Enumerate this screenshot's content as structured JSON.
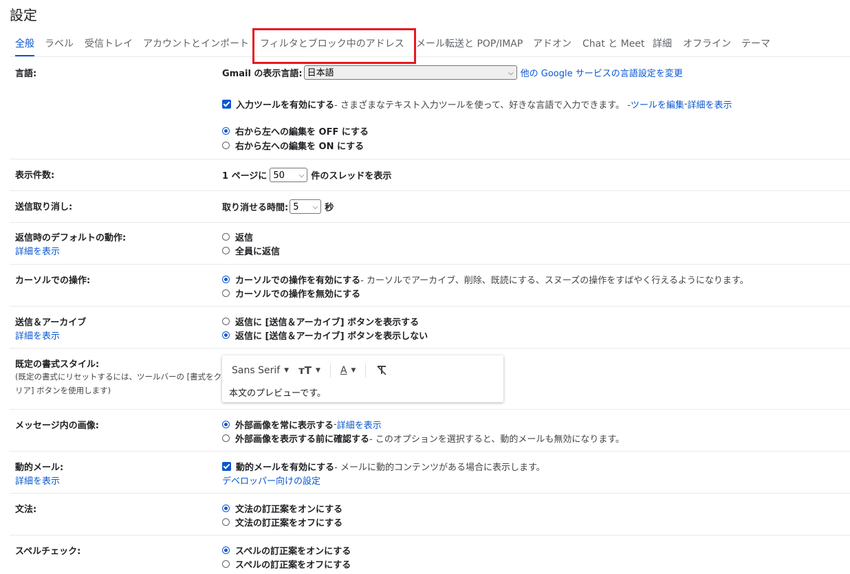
{
  "page_title": "設定",
  "tabs": [
    "全般",
    "ラベル",
    "受信トレイ",
    "アカウントとインポート",
    "フィルタとブロック中のアドレス",
    "メール転送と POP/IMAP",
    "アドオン",
    "Chat と Meet",
    "詳細",
    "オフライン",
    "テーマ"
  ],
  "active_tab": "全般",
  "highlighted_tab": "フィルタとブロック中のアドレス",
  "language": {
    "label": "言語:",
    "display_lang_label": "Gmail の表示言語:",
    "display_lang_value": "日本語",
    "other_services_link": "他の Google サービスの言語設定を変更",
    "input_tools_label": "入力ツールを有効にする",
    "input_tools_desc": " - さまざまなテキスト入力ツールを使って、好きな言語で入力できます。 - ",
    "edit_tools_link": "ツールを編集",
    "dash": " - ",
    "details_link": "詳細を表示",
    "rtl_off": "右から左への編集を OFF にする",
    "rtl_on": "右から左への編集を ON にする"
  },
  "page_size": {
    "label": "表示件数:",
    "prefix": "1 ページに",
    "value": "50",
    "suffix": "件のスレッドを表示"
  },
  "undo_send": {
    "label": "送信取り消し:",
    "prefix": "取り消せる時間:",
    "value": "5",
    "suffix": "秒"
  },
  "reply_default": {
    "label": "返信時のデフォルトの動作:",
    "details_link": "詳細を表示",
    "opt_reply": "返信",
    "opt_reply_all": "全員に返信"
  },
  "hover_actions": {
    "label": "カーソルでの操作:",
    "opt_enable": "カーソルでの操作を有効にする",
    "opt_enable_desc": " - カーソルでアーカイブ、削除、既読にする、スヌーズの操作をすばやく行えるようになります。",
    "opt_disable": "カーソルでの操作を無効にする"
  },
  "send_archive": {
    "label": "送信＆アーカイブ",
    "details_link": "詳細を表示",
    "opt_show": "返信に [送信＆アーカイブ] ボタンを表示する",
    "opt_hide": "返信に [送信＆アーカイブ] ボタンを表示しない"
  },
  "text_style": {
    "label": "既定の書式スタイル:",
    "desc": "(既定の書式にリセットするには、ツールバーの [書式をクリア] ボタンを使用します)",
    "font_name": "Sans Serif",
    "preview": "本文のプレビューです。"
  },
  "images": {
    "label": "メッセージ内の画像:",
    "opt_always": "外部画像を常に表示する",
    "dash": " - ",
    "details_link": "詳細を表示",
    "opt_ask": "外部画像を表示する前に確認する",
    "opt_ask_desc": " - このオプションを選択すると、動的メールも無効になります。"
  },
  "dynamic_email": {
    "label": "動的メール:",
    "details_link": "詳細を表示",
    "opt_enable": "動的メールを有効にする",
    "opt_enable_desc": " - メールに動的コンテンツがある場合に表示します。",
    "dev_link": "デベロッパー向けの設定"
  },
  "grammar": {
    "label": "文法:",
    "opt_on": "文法の訂正案をオンにする",
    "opt_off": "文法の訂正案をオフにする"
  },
  "spelling": {
    "label": "スペルチェック:",
    "opt_on": "スペルの訂正案をオンにする",
    "opt_off": "スペルの訂正案をオフにする"
  },
  "colors": {
    "accent": "#0b57d0",
    "highlight": "#e8181f",
    "divider": "#e8eaed"
  }
}
